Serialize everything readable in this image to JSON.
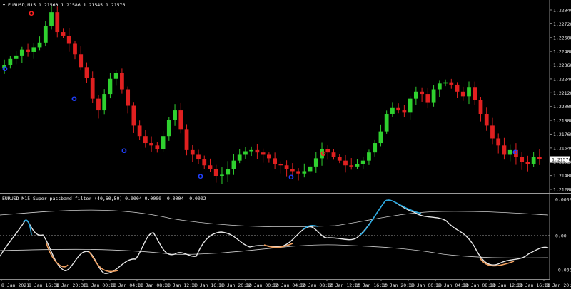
{
  "chart": {
    "symbol_header": "EURUSD,M15  1.21560 1.21586 1.21545 1.21576",
    "current_price": "1.21576"
  },
  "indicator": {
    "header": "EURUSD M15 Super passband filter (40,60,50) 0.0004 0.0000 -0.0004 -0.0002",
    "levels": [
      "0.0009",
      "0.00",
      "-0.0008"
    ]
  },
  "price_axis": [
    "1.22840",
    "1.22720",
    "1.22600",
    "1.22480",
    "1.22360",
    "1.22240",
    "1.22120",
    "1.22000",
    "1.21880",
    "1.21760",
    "1.21640",
    "1.21520",
    "1.21400",
    "1.21280"
  ],
  "time_axis": [
    "8 Jan 2021",
    "8 Jan 16:30",
    "8 Jan 20:30",
    "11 Jan 00:30",
    "11 Jan 04:30",
    "11 Jan 08:30",
    "11 Jan 12:30",
    "11 Jan 16:30",
    "11 Jan 20:30",
    "12 Jan 00:30",
    "12 Jan 04:30",
    "12 Jan 08:30",
    "12 Jan 12:30",
    "12 Jan 16:30",
    "12 Jan 20:30",
    "13 Jan 00:30",
    "13 Jan 04:30",
    "13 Jan 08:30",
    "13 Jan 12:30",
    "13 Jan 16:30",
    "13 Jan 20:30"
  ],
  "colors": {
    "background": "#000000",
    "bull_candle": "#2fd12f",
    "bear_candle": "#e02020",
    "signal_blue": "#2040ff",
    "signal_red": "#ff2020",
    "filter_line": "#e6e6e6",
    "filter_up": "#29a8e0",
    "filter_down": "#f0a060",
    "band": "#cfcfcf"
  },
  "signals": [
    {
      "type": "up",
      "glyph": "O"
    },
    {
      "type": "down",
      "glyph": "O"
    },
    {
      "type": "up",
      "glyph": "O"
    },
    {
      "type": "up",
      "glyph": "O"
    },
    {
      "type": "up",
      "glyph": "O"
    },
    {
      "type": "up",
      "glyph": "O"
    },
    {
      "type": "down",
      "glyph": "O"
    },
    {
      "type": "up",
      "glyph": "O"
    }
  ],
  "chart_data": {
    "type": "candlestick",
    "series": [
      {
        "name": "EURUSD,M15",
        "close": [
          1.2237,
          1.2242,
          1.2245,
          1.225,
          1.2248,
          1.2252,
          1.2256,
          1.227,
          1.2282,
          1.2265,
          1.2262,
          1.2255,
          1.2246,
          1.2235,
          1.2226,
          1.2208,
          1.2198,
          1.2212,
          1.2225,
          1.223,
          1.2216,
          1.2202,
          1.2185,
          1.2176,
          1.217,
          1.2168,
          1.2165,
          1.2176,
          1.219,
          1.2198,
          1.2182,
          1.2164,
          1.216,
          1.2156,
          1.2151,
          1.2148,
          1.2142,
          1.2143,
          1.2148,
          1.2155,
          1.216,
          1.2163,
          1.2164,
          1.2162,
          1.216,
          1.2157,
          1.2152,
          1.2151,
          1.2148,
          1.2146,
          1.2144,
          1.2146,
          1.215,
          1.2157,
          1.2165,
          1.2162,
          1.2158,
          1.2155,
          1.2151,
          1.215,
          1.2152,
          1.2155,
          1.2162,
          1.217,
          1.218,
          1.2195,
          1.22,
          1.2198,
          1.2196,
          1.2208,
          1.2214,
          1.2212,
          1.2205,
          1.2216,
          1.2221,
          1.2222,
          1.222,
          1.2214,
          1.221,
          1.2218,
          1.2207,
          1.2195,
          1.2185,
          1.2174,
          1.2168,
          1.216,
          1.2164,
          1.2158,
          1.2154,
          1.2152,
          1.2158,
          1.2156
        ]
      }
    ],
    "x_start": "8 Jan 2021",
    "ylim": [
      1.2128,
      1.229
    ]
  }
}
